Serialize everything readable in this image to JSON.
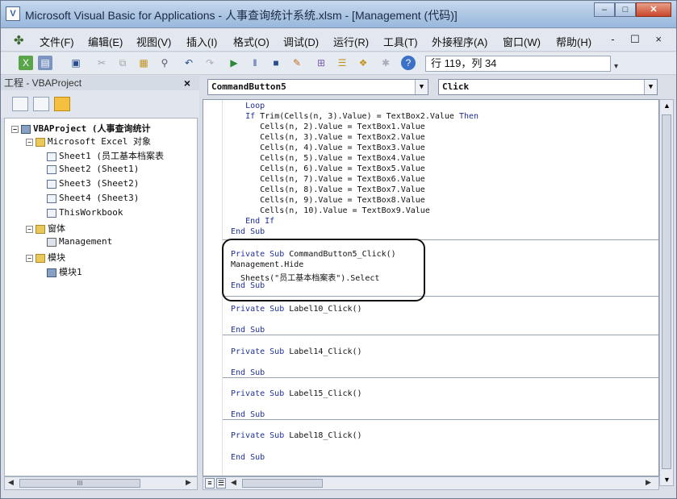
{
  "window": {
    "title": "Microsoft Visual Basic for Applications - 人事查询统计系统.xlsm - [Management (代码)]",
    "min_label": "–",
    "max_label": "□",
    "close_label": "✕"
  },
  "menu": {
    "items": [
      "文件(F)",
      "编辑(E)",
      "视图(V)",
      "插入(I)",
      "格式(O)",
      "调试(D)",
      "运行(R)",
      "工具(T)",
      "外接程序(A)",
      "窗口(W)",
      "帮助(H)"
    ],
    "mdi_controls": "- ☐ ×"
  },
  "toolbar": {
    "cursor_position": "行 119，列 34"
  },
  "project": {
    "title": "工程 - VBAProject",
    "close": "×",
    "tree": {
      "root": "VBAProject (人事查询统计",
      "excel_objects": "Microsoft Excel 对象",
      "sheets": [
        "Sheet1 (员工基本档案表",
        "Sheet2 (Sheet1)",
        "Sheet3 (Sheet2)",
        "Sheet4 (Sheet3)"
      ],
      "workbook": "ThisWorkbook",
      "forms_folder": "窗体",
      "form": "Management",
      "modules_folder": "模块",
      "module": "模块1"
    },
    "scroll_label": "III"
  },
  "code": {
    "object_combo": "CommandButton5",
    "proc_combo": "Click",
    "lines": [
      {
        "indent": "   ",
        "text": "Loop"
      },
      {
        "indent": "   ",
        "text": "If Trim(Cells(n, 3).Value) = TextBox2.Value Then"
      },
      {
        "indent": "      ",
        "text": "Cells(n, 2).Value = TextBox1.Value"
      },
      {
        "indent": "      ",
        "text": "Cells(n, 3).Value = TextBox2.Value"
      },
      {
        "indent": "      ",
        "text": "Cells(n, 4).Value = TextBox3.Value"
      },
      {
        "indent": "      ",
        "text": "Cells(n, 5).Value = TextBox4.Value"
      },
      {
        "indent": "      ",
        "text": "Cells(n, 6).Value = TextBox5.Value"
      },
      {
        "indent": "      ",
        "text": "Cells(n, 7).Value = TextBox6.Value"
      },
      {
        "indent": "      ",
        "text": "Cells(n, 8).Value = TextBox7.Value"
      },
      {
        "indent": "      ",
        "text": "Cells(n, 9).Value = TextBox8.Value"
      },
      {
        "indent": "      ",
        "text": "Cells(n, 10).Value = TextBox9.Value"
      },
      {
        "indent": "   ",
        "text": "End If"
      },
      {
        "indent": "",
        "text": "End Sub"
      },
      {
        "indent": "",
        "text": "Private Sub CommandButton5_Click()"
      },
      {
        "indent": "",
        "text": "Management.Hide"
      },
      {
        "indent": "  ",
        "text": "Sheets(\"员工基本档案表\").Select"
      },
      {
        "indent": "",
        "text": "End Sub"
      },
      {
        "indent": "",
        "text": "Private Sub Label10_Click()"
      },
      {
        "indent": "",
        "text": "End Sub"
      },
      {
        "indent": "",
        "text": "Private Sub Label14_Click()"
      },
      {
        "indent": "",
        "text": "End Sub"
      },
      {
        "indent": "",
        "text": "Private Sub Label15_Click()"
      },
      {
        "indent": "",
        "text": "End Sub"
      },
      {
        "indent": "",
        "text": "Private Sub Label18_Click()"
      },
      {
        "indent": "",
        "text": "End Sub"
      }
    ]
  },
  "colors": {
    "keyword": "#1f2f9a",
    "title_bar": "#a9c3e2",
    "close_button": "#c8462a"
  }
}
